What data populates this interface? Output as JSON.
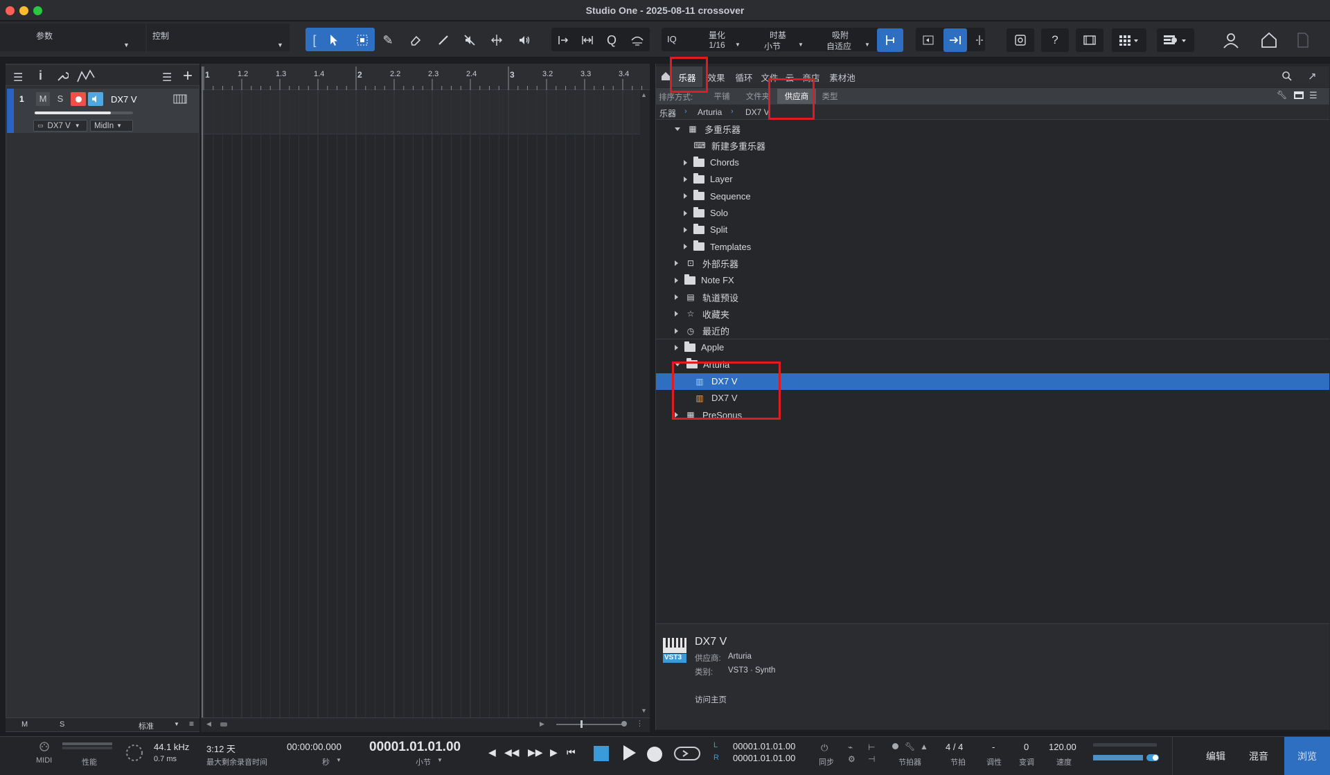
{
  "window": {
    "title": "Studio One - 2025-08-11 crossover"
  },
  "toolbar": {
    "params_label": "参数",
    "control_label": "控制",
    "iq": "IQ",
    "quantize": {
      "label": "量化",
      "value": "1/16"
    },
    "timebase": {
      "label": "时基",
      "value": "小节"
    },
    "snap": {
      "label": "吸附",
      "value": "自适应"
    }
  },
  "track": {
    "number": "1",
    "mute": "M",
    "solo": "S",
    "name": "DX7 V",
    "instrument": "DX7 V",
    "input": "MidIn",
    "footer_m": "M",
    "footer_s": "S",
    "footer_view": "标准"
  },
  "ruler": {
    "marks": [
      "1",
      "1.2",
      "1.3",
      "1.4",
      "2",
      "2.2",
      "2.3",
      "2.4",
      "3",
      "3.2",
      "3.3",
      "3.4"
    ]
  },
  "browser": {
    "tabs": [
      "乐器",
      "效果",
      "循环",
      "文件",
      "云",
      "商店",
      "素材池"
    ],
    "sort_label": "排序方式:",
    "sort_options": [
      "平铺",
      "文件夹",
      "供应商",
      "类型"
    ],
    "breadcrumb": [
      "乐器",
      "Arturia",
      "DX7 V"
    ],
    "tree": [
      {
        "label": "多重乐器",
        "level": 0,
        "icon": "multi-instrument-icon",
        "caret": "open"
      },
      {
        "label": "新建多重乐器",
        "level": 1,
        "icon": "keyboard-icon",
        "caret": "none"
      },
      {
        "label": "Chords",
        "level": 1,
        "icon": "folder-icon",
        "caret": "closed"
      },
      {
        "label": "Layer",
        "level": 1,
        "icon": "folder-icon",
        "caret": "closed"
      },
      {
        "label": "Sequence",
        "level": 1,
        "icon": "folder-icon",
        "caret": "closed"
      },
      {
        "label": "Solo",
        "level": 1,
        "icon": "folder-icon",
        "caret": "closed"
      },
      {
        "label": "Split",
        "level": 1,
        "icon": "folder-icon",
        "caret": "closed"
      },
      {
        "label": "Templates",
        "level": 1,
        "icon": "folder-icon",
        "caret": "closed"
      },
      {
        "label": "外部乐器",
        "level": 0,
        "icon": "external-instrument-icon",
        "caret": "closed"
      },
      {
        "label": "Note FX",
        "level": 0,
        "icon": "folder-icon",
        "caret": "closed"
      },
      {
        "label": "轨道预设",
        "level": 0,
        "icon": "track-preset-icon",
        "caret": "closed"
      },
      {
        "label": "收藏夹",
        "level": 0,
        "icon": "star-icon",
        "caret": "closed"
      },
      {
        "label": "最近的",
        "level": 0,
        "icon": "clock-icon",
        "caret": "closed"
      },
      {
        "label": "Apple",
        "level": 0,
        "icon": "folder-icon",
        "caret": "closed"
      },
      {
        "label": "Arturia",
        "level": 0,
        "icon": "folder-icon",
        "caret": "open"
      },
      {
        "label": "DX7 V",
        "level": 1,
        "icon": "vst3-icon",
        "caret": "none",
        "selected": true
      },
      {
        "label": "DX7 V",
        "level": 1,
        "icon": "au-icon",
        "caret": "none"
      },
      {
        "label": "PreSonus",
        "level": 0,
        "icon": "presonus-icon",
        "caret": "closed"
      }
    ],
    "info": {
      "name": "DX7 V",
      "badge": "VST3",
      "vendor_label": "供应商:",
      "vendor": "Arturia",
      "category_label": "类别:",
      "category": "VST3 · Synth",
      "homepage": "访问主页"
    }
  },
  "transport": {
    "midi": "MIDI",
    "performance": "性能",
    "sample_rate": "44.1 kHz",
    "latency": "0.7 ms",
    "record_time": "3:12 天",
    "record_time_label": "最大剩余录音时间",
    "time_sec": "00:00:00.000",
    "time_sec_unit": "秒",
    "position": "00001.01.01.00",
    "position_unit": "小节",
    "loop_l": "00001.01.01.00",
    "loop_r": "00001.01.01.00",
    "l": "L",
    "r": "R",
    "sync": "同步",
    "metronome": "节拍器",
    "signature": "4 / 4",
    "signature_label": "节拍",
    "key": "-",
    "key_label": "调性",
    "transpose": "0",
    "transpose_label": "变调",
    "tempo": "120.00",
    "tempo_label": "速度",
    "edit": "编辑",
    "mix": "混音",
    "browse": "浏览"
  },
  "colors": {
    "accent": "#2f6fc2",
    "highlight": "#e11b22",
    "record": "#f0504a",
    "monitor": "#4fa9e0"
  }
}
